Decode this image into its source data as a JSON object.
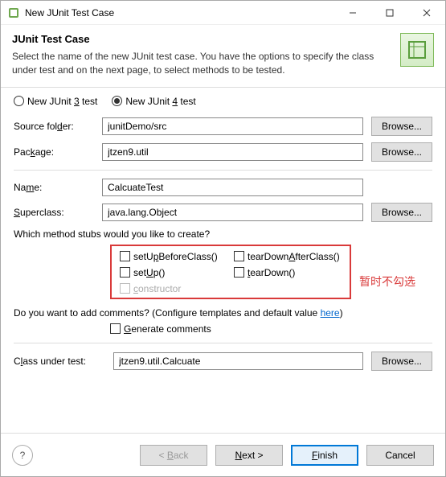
{
  "titlebar": {
    "title": "New JUnit Test Case"
  },
  "header": {
    "title": "JUnit Test Case",
    "desc": "Select the name of the new JUnit test case. You have the options to specify the class under test and on the next page, to select methods to be tested."
  },
  "radios": {
    "junit3_pre": "New JUnit ",
    "junit3_key": "3",
    "junit3_post": " test",
    "junit4_pre": "New JUnit ",
    "junit4_key": "4",
    "junit4_post": " test"
  },
  "labels": {
    "sourceFolder_pre": "Source fol",
    "sourceFolder_key": "d",
    "sourceFolder_post": "er:",
    "package_pre": "Pac",
    "package_key": "k",
    "package_post": "age:",
    "name_pre": "Na",
    "name_key": "m",
    "name_post": "e:",
    "superclass_pre": "",
    "superclass_key": "S",
    "superclass_post": "uperclass:",
    "classUnderTest_pre": "C",
    "classUnderTest_key": "l",
    "classUnderTest_post": "ass under test:"
  },
  "values": {
    "sourceFolder": "junitDemo/src",
    "package": "jtzen9.util",
    "name": "CalcuateTest",
    "superclass": "java.lang.Object",
    "classUnderTest": "jtzen9.util.Calcuate"
  },
  "buttons": {
    "browse1": "Browse...",
    "browse2": "Browse...",
    "browse3": "Browse...",
    "browse4": "Browse...",
    "back_pre": "< ",
    "back_key": "B",
    "back_post": "ack",
    "next_pre": "",
    "next_key": "N",
    "next_post": "ext >",
    "finish_pre": "",
    "finish_key": "F",
    "finish_post": "inish",
    "cancel": "Cancel",
    "help": "?"
  },
  "stubs": {
    "question": "Which method stubs would you like to create?",
    "setUpBeforeClass_pre": "setU",
    "setUpBeforeClass_key": "p",
    "setUpBeforeClass_post": "BeforeClass()",
    "tearDownAfterClass_pre": "tearDown",
    "tearDownAfterClass_key": "A",
    "tearDownAfterClass_post": "fterClass()",
    "setUp_pre": "set",
    "setUp_key": "U",
    "setUp_post": "p()",
    "tearDown_pre": "",
    "tearDown_key": "t",
    "tearDown_post": "earDown()",
    "constructor_pre": "",
    "constructor_key": "c",
    "constructor_post": "onstructor"
  },
  "comments": {
    "q_pre": "Do you want to add comments? (Configure templates and default value ",
    "link": "here",
    "q_post": ")",
    "gen_pre": "",
    "gen_key": "G",
    "gen_post": "enerate comments"
  },
  "annotation": "暂时不勾选",
  "colors": {
    "highlight": "#d93a3a",
    "accent": "#0078d7"
  }
}
